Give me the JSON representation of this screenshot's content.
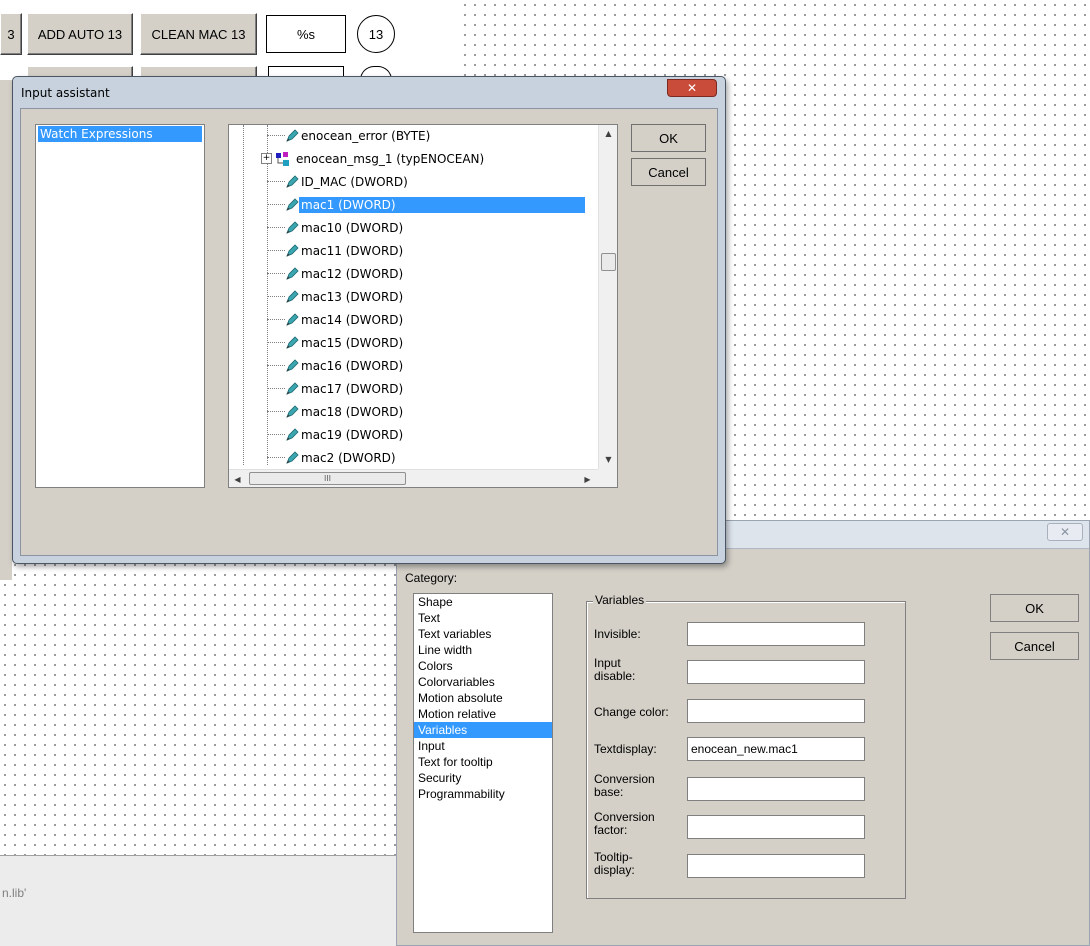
{
  "toolbar": {
    "partial_label": "3",
    "add_auto_label": "ADD AUTO 13",
    "clean_mac_label": "CLEAN MAC 13",
    "format_label": "%s",
    "circle_label": "13"
  },
  "status_text": "n.lib'",
  "input_assistant": {
    "title": "Input assistant",
    "categories": [
      "Watch Expressions"
    ],
    "tree_items": [
      {
        "label": "enocean_error (BYTE)"
      },
      {
        "label": "enocean_msg_1 (typENOCEAN)"
      },
      {
        "label": "ID_MAC (DWORD)"
      },
      {
        "label": "mac1 (DWORD)"
      },
      {
        "label": "mac10 (DWORD)"
      },
      {
        "label": "mac11 (DWORD)"
      },
      {
        "label": "mac12 (DWORD)"
      },
      {
        "label": "mac13 (DWORD)"
      },
      {
        "label": "mac14 (DWORD)"
      },
      {
        "label": "mac15 (DWORD)"
      },
      {
        "label": "mac16 (DWORD)"
      },
      {
        "label": "mac17 (DWORD)"
      },
      {
        "label": "mac18 (DWORD)"
      },
      {
        "label": "mac19 (DWORD)"
      },
      {
        "label": "mac2 (DWORD)"
      }
    ],
    "selected_item": "mac1 (DWORD)",
    "expand_symbol": "+",
    "hscroll_grip": "III",
    "ok_label": "OK",
    "cancel_label": "Cancel",
    "close_symbol": "✕"
  },
  "config_dialog": {
    "close_symbol": "✕",
    "category_caption": "Category:",
    "categories": [
      "Shape",
      "Text",
      "Text variables",
      "Line width",
      "Colors",
      "Colorvariables",
      "Motion absolute",
      "Motion relative",
      "Variables",
      "Input",
      "Text for tooltip",
      "Security",
      "Programmability"
    ],
    "selected_category": "Variables",
    "group_title": "Variables",
    "fields": [
      {
        "label": "Invisible:",
        "value": ""
      },
      {
        "label": "Input\ndisable:",
        "value": ""
      },
      {
        "label": "Change color:",
        "value": ""
      },
      {
        "label": "Textdisplay:",
        "value": "enocean_new.mac1"
      },
      {
        "label": "Conversion\nbase:",
        "value": ""
      },
      {
        "label": "Conversion\nfactor:",
        "value": ""
      },
      {
        "label": "Tooltip-\ndisplay:",
        "value": ""
      }
    ],
    "ok_label": "OK",
    "cancel_label": "Cancel"
  },
  "colors": {
    "selection": "#3399ff",
    "dialog_face": "#d4d0c8",
    "close_red": "#c94b3a",
    "frame_glass": "#c7d2de"
  },
  "icons": {
    "variable": "variable-pencil-icon",
    "struct": "struct-type-icon"
  }
}
